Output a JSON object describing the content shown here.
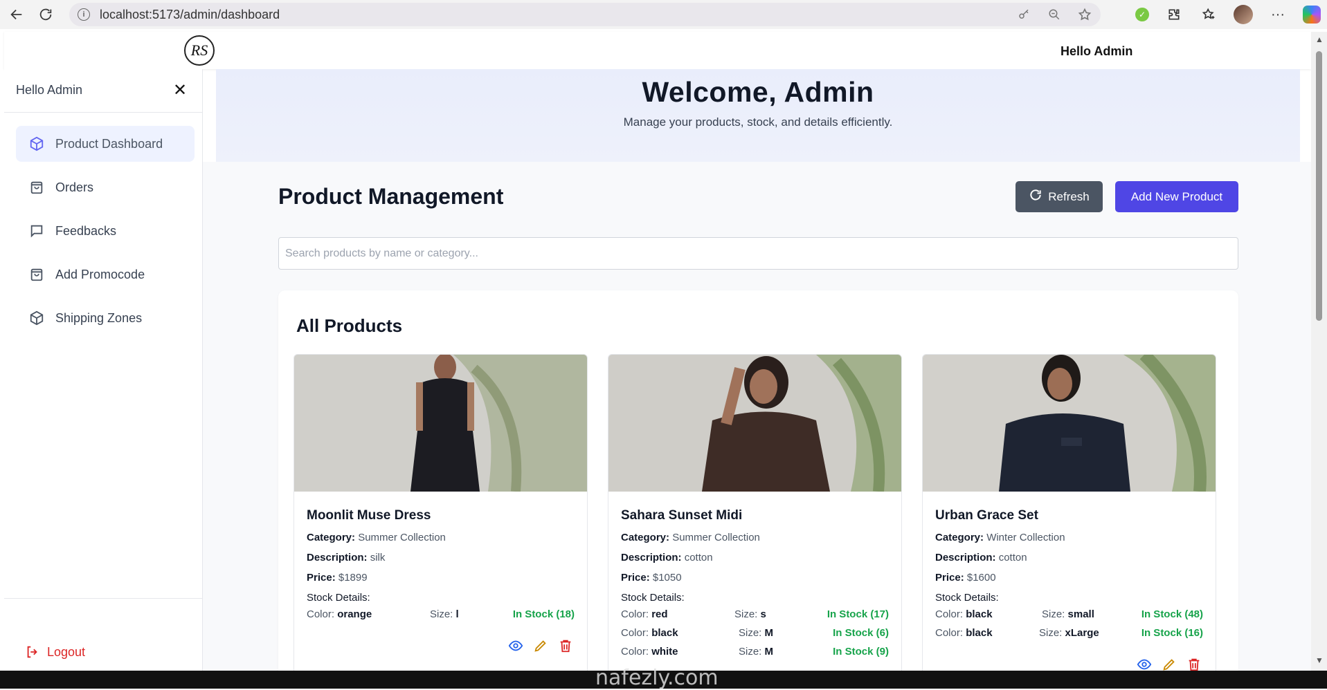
{
  "browser": {
    "url": "localhost:5173/admin/dashboard"
  },
  "header": {
    "logo_text": "RS",
    "greeting": "Hello Admin"
  },
  "sidebar": {
    "greeting": "Hello Admin",
    "items": [
      {
        "label": "Product Dashboard",
        "icon": "cube-icon",
        "active": true
      },
      {
        "label": "Orders",
        "icon": "shopping-bag-icon",
        "active": false
      },
      {
        "label": "Feedbacks",
        "icon": "message-icon",
        "active": false
      },
      {
        "label": "Add Promocode",
        "icon": "shopping-bag-icon",
        "active": false
      },
      {
        "label": "Shipping Zones",
        "icon": "cube-icon",
        "active": false
      }
    ],
    "logout_label": "Logout"
  },
  "welcome": {
    "title": "Welcome, Admin",
    "subtitle": "Manage your products, stock, and details efficiently."
  },
  "main": {
    "title": "Product Management",
    "refresh_label": "Refresh",
    "add_label": "Add New Product",
    "search_placeholder": "Search products by name or category...",
    "panel_title": "All Products"
  },
  "labels": {
    "category": "Category:",
    "description": "Description:",
    "price": "Price:",
    "stock_details": "Stock Details:",
    "color": "Color:",
    "size": "Size:"
  },
  "products": [
    {
      "name": "Moonlit Muse Dress",
      "category": "Summer Collection",
      "description": "silk",
      "price": "$1899",
      "stock": [
        {
          "color": "orange",
          "size": "l",
          "status": "In Stock (18)"
        }
      ]
    },
    {
      "name": "Sahara Sunset Midi",
      "category": "Summer Collection",
      "description": "cotton",
      "price": "$1050",
      "stock": [
        {
          "color": "red",
          "size": "s",
          "status": "In Stock (17)"
        },
        {
          "color": "black",
          "size": "M",
          "status": "In Stock (6)"
        },
        {
          "color": "white",
          "size": "M",
          "status": "In Stock (9)"
        }
      ]
    },
    {
      "name": "Urban Grace Set",
      "category": "Winter Collection",
      "description": "cotton",
      "price": "$1600",
      "stock": [
        {
          "color": "black",
          "size": "small",
          "status": "In Stock (48)"
        },
        {
          "color": "black",
          "size": "xLarge",
          "status": "In Stock (16)"
        }
      ]
    }
  ],
  "watermark": "nafezly.com",
  "colors": {
    "primary": "#4f46e5",
    "secondary": "#4b5563",
    "in_stock": "#16a34a",
    "logout": "#dc2626"
  }
}
